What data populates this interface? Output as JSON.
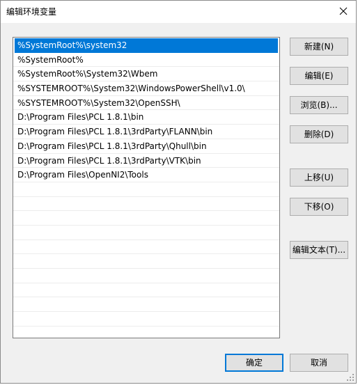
{
  "window": {
    "title": "编辑环境变量"
  },
  "paths": [
    "%SystemRoot%\\system32",
    "%SystemRoot%",
    "%SystemRoot%\\System32\\Wbem",
    "%SYSTEMROOT%\\System32\\WindowsPowerShell\\v1.0\\",
    "%SYSTEMROOT%\\System32\\OpenSSH\\",
    "D:\\Program Files\\PCL 1.8.1\\bin",
    "D:\\Program Files\\PCL 1.8.1\\3rdParty\\FLANN\\bin",
    "D:\\Program Files\\PCL 1.8.1\\3rdParty\\Qhull\\bin",
    "D:\\Program Files\\PCL 1.8.1\\3rdParty\\VTK\\bin",
    "D:\\Program Files\\OpenNI2\\Tools"
  ],
  "selected_index": 0,
  "buttons": {
    "new": "新建(N)",
    "edit": "编辑(E)",
    "browse": "浏览(B)...",
    "delete": "删除(D)",
    "move_up": "上移(U)",
    "move_down": "下移(O)",
    "edit_text": "编辑文本(T)...",
    "ok": "确定",
    "cancel": "取消"
  },
  "colors": {
    "selection": "#0078d7",
    "button_face": "#e1e1e1",
    "dialog_bg": "#f0f0f0"
  },
  "icons": {
    "close": "close-icon",
    "size_grip": "size-grip-icon"
  }
}
